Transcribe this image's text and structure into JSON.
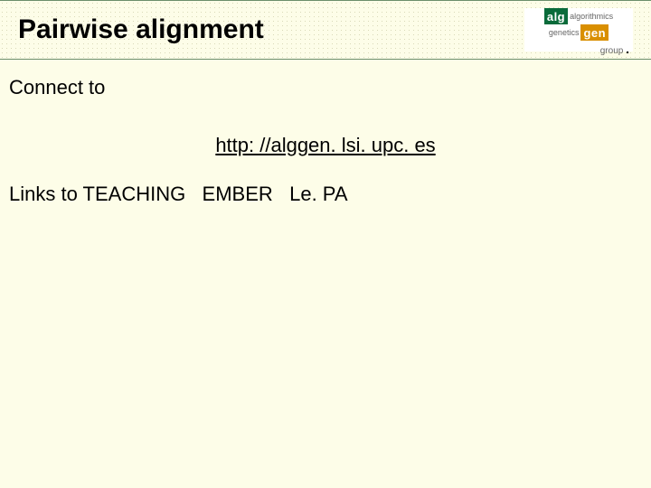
{
  "header": {
    "title": "Pairwise alignment"
  },
  "logo": {
    "alg_box": "alg",
    "algorithmics": "algorithmics",
    "genetics": "genetics",
    "gen_box": "gen",
    "group": "group",
    "dot": "."
  },
  "body": {
    "connect": "Connect to",
    "url": "http: //alggen. lsi. upc. es",
    "links": "Links to TEACHING   EMBER   Le. PA"
  }
}
